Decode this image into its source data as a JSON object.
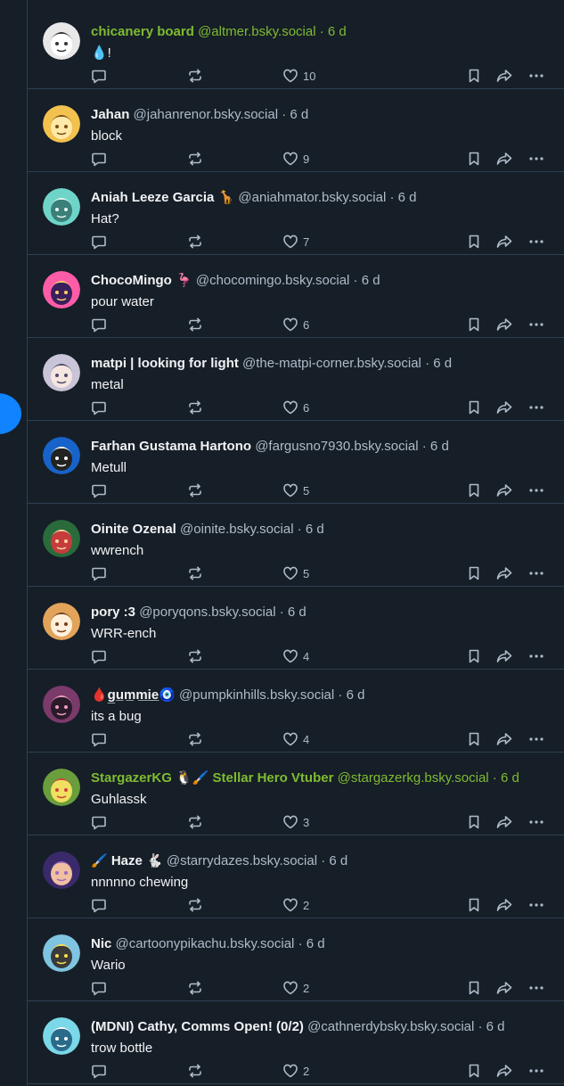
{
  "colors": {
    "background": "#161e27",
    "divider": "#2e4052",
    "text": "#f1f3f5",
    "muted": "#aebbc9",
    "highlight_green": "#7fbb32",
    "fab_blue": "#1083fe"
  },
  "icons": {
    "reply": "speech-bubble-icon",
    "repost": "repost-arrows-icon",
    "like": "heart-icon",
    "bookmark": "bookmark-icon",
    "share": "share-arrow-icon",
    "more": "ellipsis-icon"
  },
  "fab": {
    "glyph": "."
  },
  "posts": [
    {
      "name": "chicanery board",
      "handle": "@altmer.bsky.social",
      "time": "· 6 d",
      "text": "💧!",
      "likes": "10",
      "green": true
    },
    {
      "name": "Jahan",
      "handle": "@jahanrenor.bsky.social",
      "time": "· 6 d",
      "text": "block",
      "likes": "9",
      "green": false
    },
    {
      "name": "Aniah Leeze Garcia 🦒",
      "handle": "@aniahmator.bsky.social",
      "time": "· 6 d",
      "text": "Hat?",
      "likes": "7",
      "green": false
    },
    {
      "name": "ChocoMingo 🦩",
      "handle": "@chocomingo.bsky.social",
      "time": "· 6 d",
      "text": "pour water",
      "likes": "6",
      "green": false
    },
    {
      "name": "matpi | looking for light",
      "handle": "@the-matpi-corner.bsky.social",
      "time": "· 6 d",
      "text": "metal",
      "likes": "6",
      "green": false
    },
    {
      "name": "Farhan Gustama Hartono",
      "handle": "@fargusno7930.bsky.social",
      "time": "· 6 d",
      "text": "Metull",
      "likes": "5",
      "green": false
    },
    {
      "name": "Oinite Ozenal",
      "handle": "@oinite.bsky.social",
      "time": "· 6 d",
      "text": "wwrench",
      "likes": "5",
      "green": false
    },
    {
      "name": "pory :3",
      "handle": "@poryqons.bsky.social",
      "time": "· 6 d",
      "text": "WRR-ench",
      "likes": "4",
      "green": false
    },
    {
      "name": "🩸g̲u̲m̲m̲i̲e̲🧿",
      "handle": "@pumpkinhills.bsky.social",
      "time": "· 6 d",
      "text": "its a bug",
      "likes": "4",
      "green": false
    },
    {
      "name": "StargazerKG 🐧🖌️ Stellar Hero Vtuber",
      "handle": "@stargazerkg.bsky.social",
      "time": "· 6 d",
      "text": "Guhlassk",
      "likes": "3",
      "green": true
    },
    {
      "name": "🖌️ Haze 🐇",
      "handle": "@starrydazes.bsky.social",
      "time": "· 6 d",
      "text": "nnnnno chewing",
      "likes": "2",
      "green": false
    },
    {
      "name": "Nic",
      "handle": "@cartoonypikachu.bsky.social",
      "time": "· 6 d",
      "text": "Wario",
      "likes": "2",
      "green": false
    },
    {
      "name": "(MDNI) Cathy, Comms Open! (0/2)",
      "handle": "@cathnerdybsky.bsky.social",
      "time": "· 6 d",
      "text": "trow bottle",
      "likes": "2",
      "green": false
    }
  ]
}
